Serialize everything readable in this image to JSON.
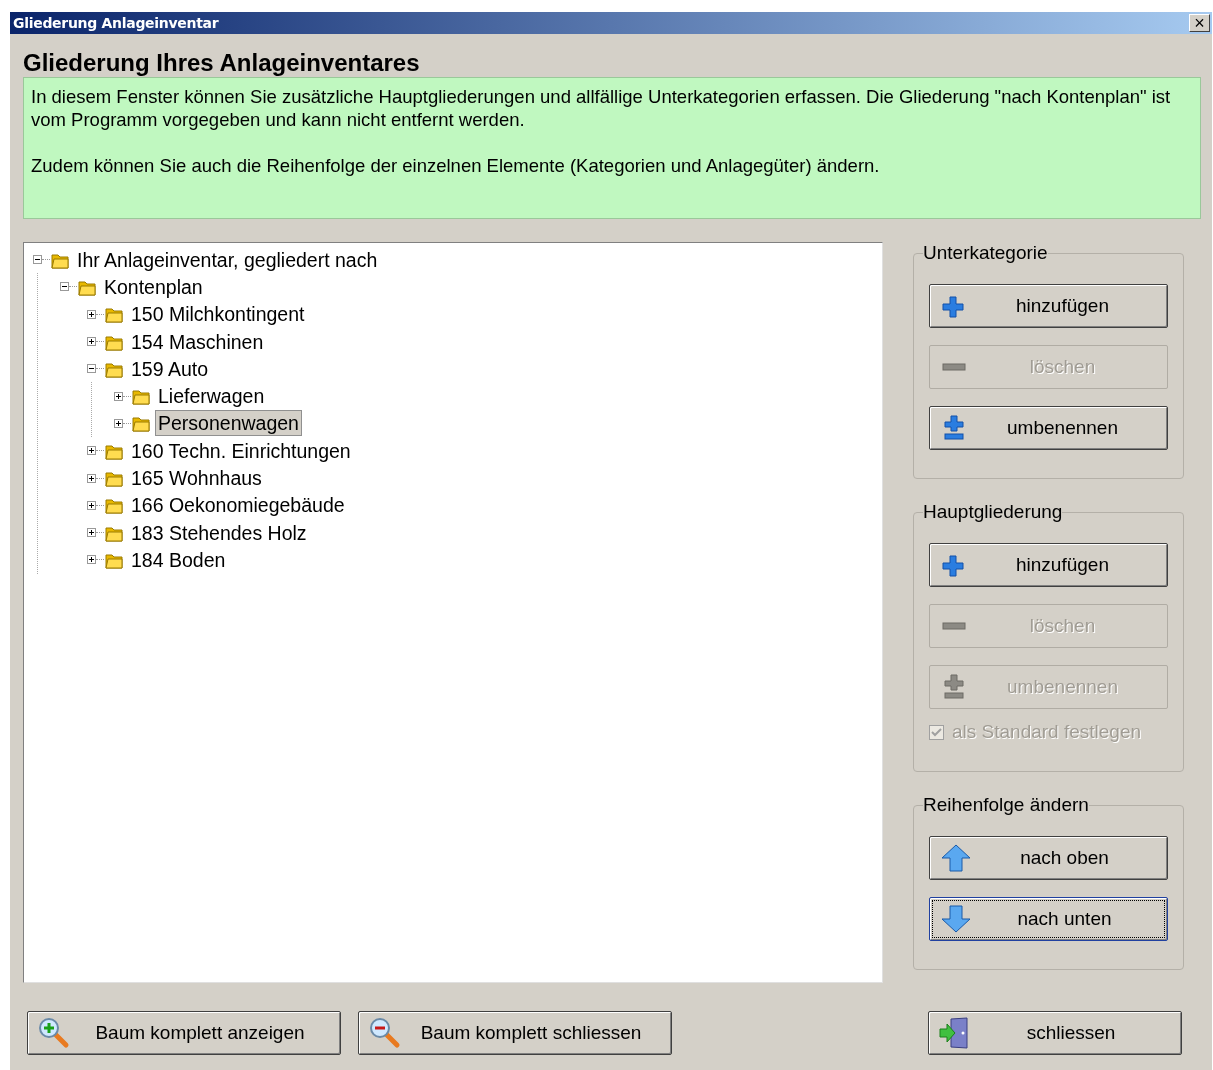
{
  "window": {
    "title": "Gliederung Anlageinventar",
    "close": "×"
  },
  "heading": "Gliederung Ihres Anlageinventares",
  "info": [
    "In diesem Fenster können Sie zusätzliche Hauptgliederungen und allfällige Unterkategorien erfassen. Die Gliederung \"nach Kontenplan\" ist vom Programm vorgegeben und kann nicht entfernt werden.",
    "Zudem können Sie auch die Reihenfolge der einzelnen Elemente (Kategorien und Anlagegüter) ändern."
  ],
  "tree": [
    {
      "label": "Ihr Anlageinventar, gegliedert nach",
      "expanded": true,
      "selected": false,
      "children": [
        {
          "label": "Kontenplan",
          "expanded": true,
          "selected": false,
          "children": [
            {
              "label": "150 Milchkontingent",
              "expanded": false,
              "selected": false,
              "has_children": true
            },
            {
              "label": "154 Maschinen",
              "expanded": false,
              "selected": false,
              "has_children": true
            },
            {
              "label": "159 Auto",
              "expanded": true,
              "selected": false,
              "children": [
                {
                  "label": "Lieferwagen",
                  "expanded": false,
                  "selected": false,
                  "has_children": true
                },
                {
                  "label": "Personenwagen",
                  "expanded": false,
                  "selected": true,
                  "has_children": true
                }
              ]
            },
            {
              "label": "160 Techn. Einrichtungen",
              "expanded": false,
              "selected": false,
              "has_children": true
            },
            {
              "label": "165 Wohnhaus",
              "expanded": false,
              "selected": false,
              "has_children": true
            },
            {
              "label": "166 Oekonomiegebäude",
              "expanded": false,
              "selected": false,
              "has_children": true
            },
            {
              "label": "183 Stehendes Holz",
              "expanded": false,
              "selected": false,
              "has_children": true
            },
            {
              "label": "184 Boden",
              "expanded": false,
              "selected": false,
              "has_children": true
            }
          ]
        }
      ]
    }
  ],
  "groups": [
    {
      "title": "Unterkategorie",
      "items": [
        {
          "kind": "add",
          "label": "hinzufügen",
          "disabled": false,
          "focused": false
        },
        {
          "kind": "delete",
          "label": "löschen",
          "disabled": true,
          "focused": false
        },
        {
          "kind": "rename",
          "label": "umbenennen",
          "disabled": false,
          "focused": false
        }
      ]
    },
    {
      "title": "Hauptgliederung",
      "items": [
        {
          "kind": "add",
          "label": "hinzufügen",
          "disabled": false,
          "focused": false
        },
        {
          "kind": "delete",
          "label": "löschen",
          "disabled": true,
          "focused": false
        },
        {
          "kind": "rename",
          "label": "umbenennen",
          "disabled": true,
          "focused": false
        },
        {
          "kind": "checkbox",
          "label": "als Standard festlegen",
          "checked": true,
          "disabled": true
        }
      ]
    },
    {
      "title": "Reihenfolge ändern",
      "items": [
        {
          "kind": "up",
          "label": "nach oben",
          "disabled": false,
          "focused": false
        },
        {
          "kind": "down",
          "label": "nach unten",
          "disabled": false,
          "focused": true
        }
      ]
    }
  ],
  "bottom_buttons": [
    {
      "kind": "expand-all",
      "label": "Baum komplett anzeigen"
    },
    {
      "kind": "collapse-all",
      "label": "Baum komplett schliessen"
    }
  ],
  "close_button": {
    "kind": "exit",
    "label": "schliessen"
  }
}
